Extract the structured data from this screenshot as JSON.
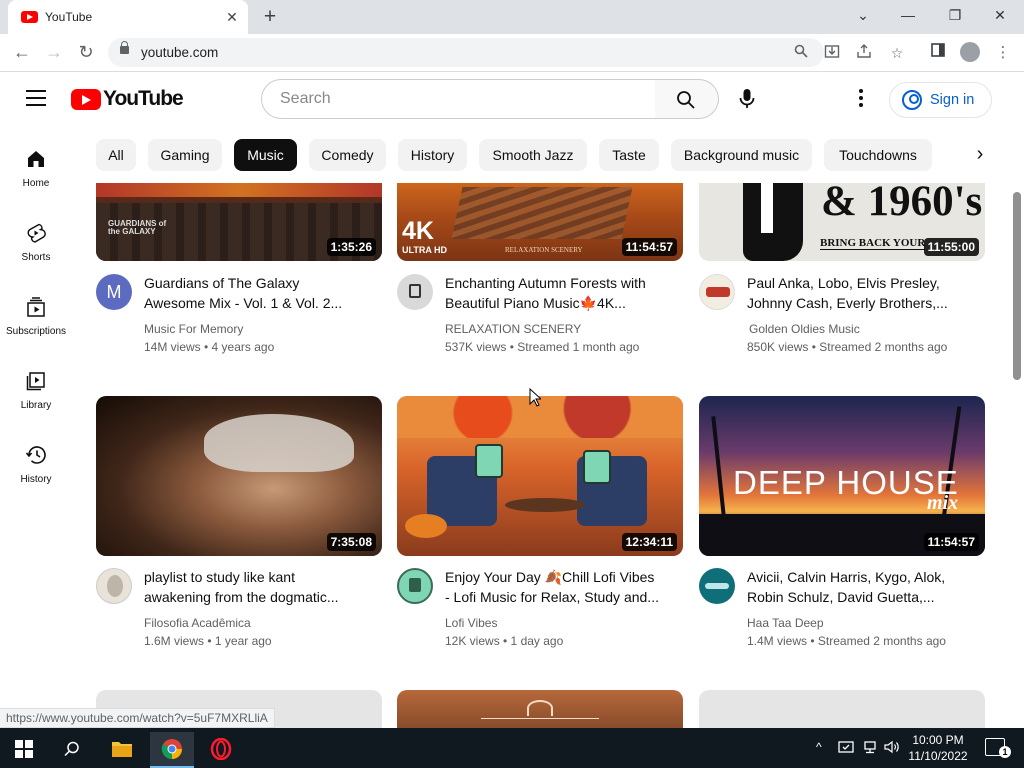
{
  "browser": {
    "tab_title": "YouTube",
    "url": "youtube.com",
    "status_url": "https://www.youtube.com/watch?v=5uF7MXRLliA"
  },
  "header": {
    "logo_text": "YouTube",
    "search_placeholder": "Search",
    "signin_label": "Sign in"
  },
  "guide": [
    {
      "label": "Home",
      "icon": "home-icon"
    },
    {
      "label": "Shorts",
      "icon": "shorts-icon"
    },
    {
      "label": "Subscriptions",
      "icon": "subscriptions-icon"
    },
    {
      "label": "Library",
      "icon": "library-icon"
    },
    {
      "label": "History",
      "icon": "history-icon"
    }
  ],
  "chips": [
    "All",
    "Gaming",
    "Music",
    "Comedy",
    "History",
    "Smooth Jazz",
    "Taste",
    "Background music",
    "Touchdowns"
  ],
  "active_chip": "Music",
  "videos": [
    {
      "title_line1": "Guardians of The Galaxy",
      "title_line2": "Awesome Mix - Vol. 1 & Vol. 2...",
      "channel": "Music For Memory",
      "meta": "14M views • 4 years ago",
      "duration": "1:35:26",
      "avatar_letter": "M",
      "thumb_text": "GUARDIANS of the GALAXY"
    },
    {
      "title_line1": "Enchanting Autumn Forests with",
      "title_line2": "Beautiful Piano Music🍁4K...",
      "channel": "RELAXATION SCENERY",
      "meta": "537K views • Streamed 1 month ago",
      "duration": "11:54:57",
      "thumb_text": "4K",
      "thumb_sub": "ULTRA HD",
      "thumb_brand": "RELAXATION SCENERY"
    },
    {
      "title_line1": "Paul Anka, Lobo, Elvis Presley,",
      "title_line2": "Johnny Cash, Everly Brothers,...",
      "channel": "Golden Oldies Music",
      "meta": "850K views • Streamed 2 months ago",
      "duration": "11:55:00",
      "thumb_text": "& 1960's",
      "thumb_sub": "BRING BACK YOUR"
    },
    {
      "title_line1": "playlist to study like kant",
      "title_line2": "awakening from the dogmatic...",
      "channel": "Filosofia Acadêmica",
      "meta": "1.6M views • 1 year ago",
      "duration": "7:35:08"
    },
    {
      "title_line1": "Enjoy Your Day 🍂Chill Lofi Vibes",
      "title_line2": "- Lofi Music for Relax, Study and...",
      "channel": "Lofi Vibes",
      "meta": "12K views • 1 day ago",
      "duration": "12:34:11"
    },
    {
      "title_line1": "Avicii, Calvin Harris, Kygo, Alok,",
      "title_line2": "Robin Schulz, David Guetta,...",
      "channel": "Haa Taa Deep",
      "meta": "1.4M views • Streamed 2 months ago",
      "duration": "11:54:57",
      "thumb_text": "DEEP HOUSE",
      "thumb_sub": "mix"
    }
  ],
  "taskbar": {
    "time": "10:00 PM",
    "date": "11/10/2022",
    "notification_count": "1"
  }
}
